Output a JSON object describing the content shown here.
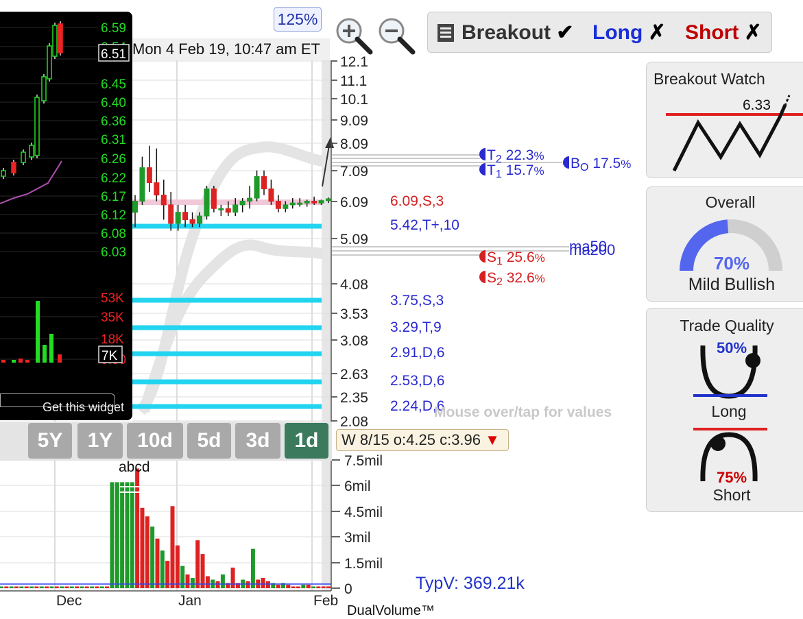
{
  "header": {
    "datetime": "Mon 4 Feb 19, 10:47 am ET",
    "zoom": "125%"
  },
  "toolbar": {
    "breakout_label": "Breakout",
    "breakout_mark": "✔",
    "long_label": "Long",
    "long_mark": "✗",
    "short_label": "Short",
    "short_mark": "✗",
    "colors": {
      "long": "#1a2ed6",
      "short": "#c00000"
    }
  },
  "widget": {
    "footer": "Get this widget",
    "price_ticks": [
      "6.59",
      "6.54",
      "6.51",
      "6.45",
      "6.40",
      "6.36",
      "6.31",
      "6.26",
      "6.22",
      "6.17",
      "6.12",
      "6.08",
      "6.03"
    ],
    "current_price": "6.51",
    "volume_ticks": [
      "53K",
      "35K",
      "18K",
      "0.00"
    ],
    "current_volume": "7K"
  },
  "ranges": [
    "5Y",
    "1Y",
    "10d",
    "5d",
    "3d",
    "1d"
  ],
  "active_range": "1d",
  "info": {
    "text": "W 8/15 o:4.25 c:3.96",
    "arrow": "▼"
  },
  "hint": "Mouse over/tap for values",
  "typv": "TypV: 369.21k",
  "dual_volume": "DualVolume™",
  "panels": {
    "breakout_watch": {
      "title": "Breakout Watch",
      "level": "6.33"
    },
    "overall": {
      "title": "Overall",
      "percent": "70%",
      "label": "Mild Bullish"
    },
    "trade_quality": {
      "title": "Trade Quality",
      "long_pct": "50%",
      "long_label": "Long",
      "short_pct": "75%",
      "short_label": "Short"
    }
  },
  "chart_data": {
    "type": "candlestick",
    "price_axis_ticks": [
      "12.1",
      "11.1",
      "10.1",
      "9.09",
      "8.09",
      "7.09",
      "6.09",
      "5.09",
      "4.08",
      "3.53",
      "3.08",
      "2.63",
      "2.35",
      "2.08"
    ],
    "volume_axis_ticks": [
      "7.5mil",
      "6mil",
      "4.5mil",
      "3mil",
      "1.5mil",
      "0"
    ],
    "x_labels": [
      "Dec",
      "Jan",
      "Feb"
    ],
    "pattern_label": "abcd",
    "levels": [
      {
        "label": "6.09,S,3",
        "price": 6.09,
        "color": "#d42020"
      },
      {
        "label": "5.42,T+,10",
        "price": 5.42,
        "color": "#2a2ad0"
      },
      {
        "label": "3.75,S,3",
        "price": 3.75,
        "color": "#2a2ad0"
      },
      {
        "label": "3.29,T,9",
        "price": 3.29,
        "color": "#2a2ad0"
      },
      {
        "label": "2.91,D,6",
        "price": 2.91,
        "color": "#2a2ad0"
      },
      {
        "label": "2.53,D,6",
        "price": 2.53,
        "color": "#2a2ad0"
      },
      {
        "label": "2.24,D,6",
        "price": 2.24,
        "color": "#2a2ad0"
      }
    ],
    "targets": [
      {
        "name": "T",
        "sub": "2",
        "pct": "22.3",
        "unit": "%",
        "color": "#2a2ad0"
      },
      {
        "name": "T",
        "sub": "1",
        "pct": "15.7",
        "unit": "%",
        "color": "#2a2ad0"
      },
      {
        "name": "B",
        "sub": "O",
        "pct": "17.5",
        "unit": "%",
        "color": "#2a2ad0"
      },
      {
        "name": "S",
        "sub": "1",
        "pct": "25.6",
        "unit": "%",
        "color": "#d42020"
      },
      {
        "name": "S",
        "sub": "2",
        "pct": "32.6",
        "unit": "%",
        "color": "#d42020"
      }
    ],
    "ma_labels": [
      "ma50",
      "ma200"
    ],
    "candles": [
      {
        "o": 5.8,
        "h": 6.3,
        "l": 5.4,
        "c": 6.1
      },
      {
        "o": 6.1,
        "h": 7.6,
        "l": 6.0,
        "c": 7.2
      },
      {
        "o": 7.2,
        "h": 8.0,
        "l": 6.4,
        "c": 6.7
      },
      {
        "o": 6.7,
        "h": 7.9,
        "l": 6.1,
        "c": 6.3
      },
      {
        "o": 6.3,
        "h": 6.8,
        "l": 5.6,
        "c": 6.0
      },
      {
        "o": 6.0,
        "h": 6.4,
        "l": 5.3,
        "c": 5.5
      },
      {
        "o": 5.5,
        "h": 6.0,
        "l": 5.3,
        "c": 5.8
      },
      {
        "o": 5.8,
        "h": 6.0,
        "l": 5.4,
        "c": 5.6
      },
      {
        "o": 5.6,
        "h": 5.8,
        "l": 5.4,
        "c": 5.5
      },
      {
        "o": 5.5,
        "h": 5.8,
        "l": 5.4,
        "c": 5.7
      },
      {
        "o": 5.7,
        "h": 6.6,
        "l": 5.6,
        "c": 6.5
      },
      {
        "o": 6.5,
        "h": 6.6,
        "l": 5.8,
        "c": 5.9
      },
      {
        "o": 5.9,
        "h": 6.0,
        "l": 5.7,
        "c": 5.9
      },
      {
        "o": 5.9,
        "h": 6.1,
        "l": 5.7,
        "c": 5.8
      },
      {
        "o": 5.8,
        "h": 6.2,
        "l": 5.7,
        "c": 6.0
      },
      {
        "o": 6.0,
        "h": 6.2,
        "l": 5.8,
        "c": 6.1
      },
      {
        "o": 6.1,
        "h": 6.6,
        "l": 5.9,
        "c": 6.2
      },
      {
        "o": 6.2,
        "h": 7.1,
        "l": 6.1,
        "c": 6.9
      },
      {
        "o": 6.9,
        "h": 7.1,
        "l": 6.3,
        "c": 6.5
      },
      {
        "o": 6.5,
        "h": 6.8,
        "l": 6.0,
        "c": 6.1
      },
      {
        "o": 6.1,
        "h": 6.3,
        "l": 5.8,
        "c": 5.9
      },
      {
        "o": 5.9,
        "h": 6.1,
        "l": 5.8,
        "c": 6.0
      },
      {
        "o": 6.0,
        "h": 6.2,
        "l": 5.9,
        "c": 6.05
      },
      {
        "o": 6.05,
        "h": 6.2,
        "l": 5.95,
        "c": 6.05
      },
      {
        "o": 6.05,
        "h": 6.15,
        "l": 5.95,
        "c": 6.1
      },
      {
        "o": 6.1,
        "h": 6.25,
        "l": 6.0,
        "c": 6.05
      },
      {
        "o": 6.05,
        "h": 6.15,
        "l": 6.0,
        "c": 6.12
      },
      {
        "o": 6.12,
        "h": 6.22,
        "l": 6.05,
        "c": 6.18
      }
    ],
    "volumes_mil": [
      0.1,
      0.1,
      0.1,
      0.1,
      0.1,
      0.1,
      0.1,
      0.1,
      0.1,
      0.1,
      0.1,
      0.1,
      0.1,
      0.1,
      0.1,
      0.1,
      0.1,
      0.1,
      0.1,
      0.1,
      0.1,
      0.1,
      6.2,
      6.2,
      6.2,
      6.2,
      6.2,
      7.0,
      4.7,
      4.2,
      3.6,
      2.9,
      2.2,
      1.6,
      4.8,
      2.5,
      1.3,
      0.8,
      0.6,
      2.8,
      2.0,
      0.7,
      0.5,
      0.4,
      0.8,
      0.3,
      1.2,
      0.3,
      0.5,
      0.4,
      2.3,
      0.5,
      0.6,
      0.4,
      0.3,
      0.2,
      0.3,
      0.2,
      0.1,
      0.1,
      0.2,
      0.2,
      0.1,
      0.1,
      0.1,
      0.1
    ],
    "ylim": [
      2.08,
      12.1
    ],
    "volume_ylim": [
      0,
      7.5
    ]
  }
}
